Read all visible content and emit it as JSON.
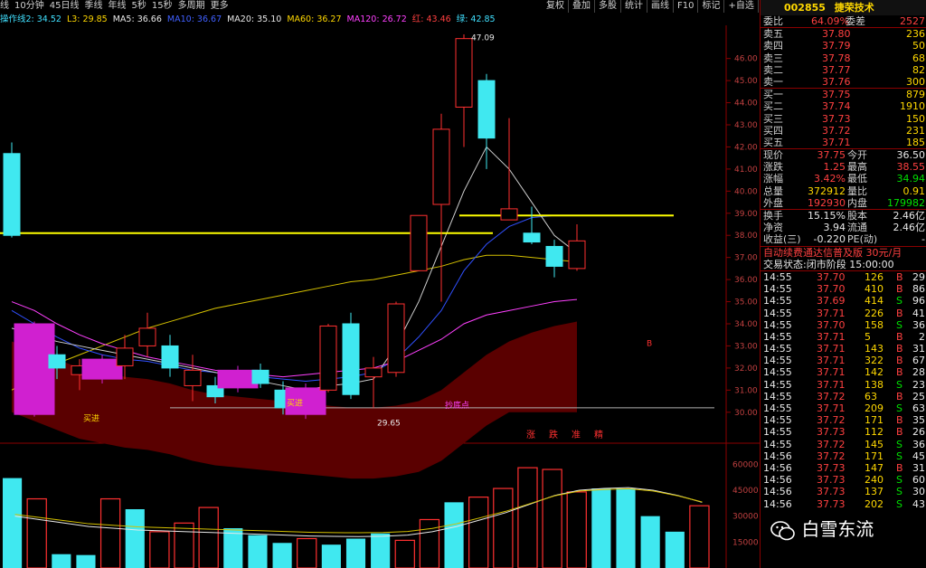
{
  "toolbar": {
    "items": [
      "线",
      "10分钟",
      "45日线",
      "季线",
      "年线",
      "5秒",
      "15秒",
      "多周期",
      "更多"
    ],
    "right_items": [
      "复权",
      "叠加",
      "多股",
      "统计",
      "画线",
      "F10",
      "标记",
      "+自选",
      "返回"
    ]
  },
  "indicators": [
    {
      "text": "操作线2: 34.52",
      "color": "#40e0ff"
    },
    {
      "text": "L3: 29.85",
      "color": "#ffd800"
    },
    {
      "text": "MA5: 36.66",
      "color": "#e8e8e8"
    },
    {
      "text": "MA10: 36.67",
      "color": "#4060ff"
    },
    {
      "text": "MA20: 35.10",
      "color": "#e8e8e8"
    },
    {
      "text": "MA60: 36.27",
      "color": "#ffd800"
    },
    {
      "text": "MA120: 26.72",
      "color": "#ff40ff"
    },
    {
      "text": "红: 43.46",
      "color": "#ff4040"
    },
    {
      "text": "绿: 42.85",
      "color": "#40e0ff"
    }
  ],
  "chart_data": {
    "type": "candlestick",
    "price_axis_ticks": [
      "46.00",
      "45.00",
      "44.00",
      "43.00",
      "42.00",
      "41.00",
      "40.00",
      "39.00",
      "38.00",
      "37.00",
      "36.00",
      "35.00",
      "34.00",
      "33.00",
      "32.00",
      "31.00",
      "30.00"
    ],
    "volume_axis_ticks": [
      "60000",
      "45000",
      "30000",
      "15000"
    ],
    "price_range": [
      29.5,
      47.5
    ],
    "annotations": {
      "high_label": "47.09",
      "low_label": "29.65",
      "buy1": "买进",
      "buy2": "买进",
      "buy3": "抄底点",
      "b_marker": "B",
      "bottom_tags": [
        "涨",
        "跌",
        "准",
        "精"
      ]
    },
    "candles": [
      {
        "o": 38.0,
        "c": 41.7,
        "h": 42.2,
        "l": 37.9,
        "color": "cyan"
      },
      {
        "o": 34.0,
        "c": 29.9,
        "h": 34.1,
        "l": 29.8,
        "color": "mag"
      },
      {
        "o": 32.0,
        "c": 32.6,
        "h": 33.0,
        "l": 31.5,
        "color": "cyan"
      },
      {
        "o": 31.7,
        "c": 32.1,
        "h": 32.4,
        "l": 31.0,
        "color": "red"
      },
      {
        "o": 31.5,
        "c": 32.4,
        "h": 32.6,
        "l": 31.3,
        "color": "mag"
      },
      {
        "o": 32.1,
        "c": 32.9,
        "h": 33.5,
        "l": 31.5,
        "color": "red"
      },
      {
        "o": 33.0,
        "c": 33.8,
        "h": 34.5,
        "l": 32.5,
        "color": "red"
      },
      {
        "o": 33.0,
        "c": 32.0,
        "h": 33.5,
        "l": 31.6,
        "color": "cyan"
      },
      {
        "o": 31.2,
        "c": 31.9,
        "h": 32.6,
        "l": 30.5,
        "color": "red"
      },
      {
        "o": 31.2,
        "c": 30.7,
        "h": 31.6,
        "l": 30.4,
        "color": "cyan"
      },
      {
        "o": 31.1,
        "c": 31.9,
        "h": 32.1,
        "l": 30.9,
        "color": "mag"
      },
      {
        "o": 31.9,
        "c": 31.3,
        "h": 32.2,
        "l": 31.1,
        "color": "cyan"
      },
      {
        "o": 31.0,
        "c": 30.2,
        "h": 31.4,
        "l": 29.9,
        "color": "cyan"
      },
      {
        "o": 29.9,
        "c": 31.1,
        "h": 31.3,
        "l": 29.7,
        "color": "mag"
      },
      {
        "o": 31.0,
        "c": 33.9,
        "h": 34.0,
        "l": 30.9,
        "color": "red"
      },
      {
        "o": 34.0,
        "c": 30.8,
        "h": 34.5,
        "l": 30.6,
        "color": "cyan"
      },
      {
        "o": 31.6,
        "c": 32.0,
        "h": 32.5,
        "l": 30.2,
        "color": "red"
      },
      {
        "o": 31.8,
        "c": 34.9,
        "h": 35.0,
        "l": 31.6,
        "color": "red"
      },
      {
        "o": 36.4,
        "c": 38.9,
        "h": 38.9,
        "l": 36.4,
        "color": "red"
      },
      {
        "o": 39.4,
        "c": 42.8,
        "h": 43.5,
        "l": 35.0,
        "color": "red"
      },
      {
        "o": 43.8,
        "c": 46.9,
        "h": 47.09,
        "l": 42.0,
        "color": "red"
      },
      {
        "o": 45.0,
        "c": 42.4,
        "h": 45.3,
        "l": 41.0,
        "color": "cyan"
      },
      {
        "o": 38.7,
        "c": 39.2,
        "h": 43.3,
        "l": 38.7,
        "color": "red"
      },
      {
        "o": 38.1,
        "c": 37.7,
        "h": 39.3,
        "l": 37.6,
        "color": "cyan"
      },
      {
        "o": 37.5,
        "c": 36.6,
        "h": 37.8,
        "l": 36.1,
        "color": "cyan"
      },
      {
        "o": 36.5,
        "c": 37.75,
        "h": 38.5,
        "l": 36.4,
        "color": "red"
      }
    ],
    "volumes": [
      {
        "v": 52000,
        "color": "cyan"
      },
      {
        "v": 40000,
        "color": "red"
      },
      {
        "v": 8000,
        "color": "cyan"
      },
      {
        "v": 7500,
        "color": "cyan"
      },
      {
        "v": 40000,
        "color": "red"
      },
      {
        "v": 34000,
        "color": "cyan"
      },
      {
        "v": 21000,
        "color": "red"
      },
      {
        "v": 26000,
        "color": "red"
      },
      {
        "v": 35000,
        "color": "red"
      },
      {
        "v": 23000,
        "color": "cyan"
      },
      {
        "v": 19000,
        "color": "cyan"
      },
      {
        "v": 14500,
        "color": "cyan"
      },
      {
        "v": 17000,
        "color": "red"
      },
      {
        "v": 13500,
        "color": "cyan"
      },
      {
        "v": 17000,
        "color": "cyan"
      },
      {
        "v": 20000,
        "color": "cyan"
      },
      {
        "v": 16000,
        "color": "red"
      },
      {
        "v": 28000,
        "color": "red"
      },
      {
        "v": 38000,
        "color": "cyan"
      },
      {
        "v": 41000,
        "color": "red"
      },
      {
        "v": 46000,
        "color": "red"
      },
      {
        "v": 58000,
        "color": "red"
      },
      {
        "v": 57000,
        "color": "red"
      },
      {
        "v": 44000,
        "color": "red"
      },
      {
        "v": 46000,
        "color": "cyan"
      },
      {
        "v": 46000,
        "color": "cyan"
      },
      {
        "v": 30000,
        "color": "cyan"
      },
      {
        "v": 21000,
        "color": "cyan"
      },
      {
        "v": 36000,
        "color": "red"
      }
    ]
  },
  "panel": {
    "code": "002855",
    "name": "捷荣技术",
    "weibi": {
      "label": "委比",
      "value": "64.09%",
      "label2": "委差",
      "value2": "2527"
    },
    "asks": [
      {
        "label": "卖五",
        "price": "37.80",
        "vol": "236"
      },
      {
        "label": "卖四",
        "price": "37.79",
        "vol": "50"
      },
      {
        "label": "卖三",
        "price": "37.78",
        "vol": "68"
      },
      {
        "label": "卖二",
        "price": "37.77",
        "vol": "82"
      },
      {
        "label": "卖一",
        "price": "37.76",
        "vol": "300"
      }
    ],
    "bids": [
      {
        "label": "买一",
        "price": "37.75",
        "vol": "879"
      },
      {
        "label": "买二",
        "price": "37.74",
        "vol": "1910"
      },
      {
        "label": "买三",
        "price": "37.73",
        "vol": "150"
      },
      {
        "label": "买四",
        "price": "37.72",
        "vol": "231"
      },
      {
        "label": "买五",
        "price": "37.71",
        "vol": "185"
      }
    ],
    "quote": [
      {
        "l1": "现价",
        "v1": "37.75",
        "c1": "red",
        "l2": "今开",
        "v2": "36.50",
        "c2": "white"
      },
      {
        "l1": "涨跌",
        "v1": "1.25",
        "c1": "red",
        "l2": "最高",
        "v2": "38.55",
        "c2": "red"
      },
      {
        "l1": "涨幅",
        "v1": "3.42%",
        "c1": "red",
        "l2": "最低",
        "v2": "34.94",
        "c2": "green"
      },
      {
        "l1": "总量",
        "v1": "372912",
        "c1": "yellow",
        "l2": "量比",
        "v2": "0.91",
        "c2": "yellow"
      },
      {
        "l1": "外盘",
        "v1": "192930",
        "c1": "red",
        "l2": "内盘",
        "v2": "179982",
        "c2": "green"
      }
    ],
    "quote2": [
      {
        "l1": "换手",
        "v1": "15.15%",
        "c1": "white",
        "l2": "股本",
        "v2": "2.46亿",
        "c2": "white"
      },
      {
        "l1": "净资",
        "v1": "3.94",
        "c1": "white",
        "l2": "流通",
        "v2": "2.46亿",
        "c2": "white"
      },
      {
        "l1": "收益(三)",
        "v1": "-0.220",
        "c1": "white",
        "l2": "PE(动)",
        "v2": "-",
        "c2": "white"
      }
    ],
    "ad": "自动续费通达信普及版 30元/月",
    "status": "交易状态:闭市阶段 15:00:00",
    "ticks": [
      {
        "t": "14:55",
        "p": "37.70",
        "v": "126",
        "s": "B",
        "n": "29"
      },
      {
        "t": "14:55",
        "p": "37.70",
        "v": "410",
        "s": "B",
        "n": "86"
      },
      {
        "t": "14:55",
        "p": "37.69",
        "v": "414",
        "s": "S",
        "n": "96"
      },
      {
        "t": "14:55",
        "p": "37.71",
        "v": "226",
        "s": "B",
        "n": "41"
      },
      {
        "t": "14:55",
        "p": "37.70",
        "v": "158",
        "s": "S",
        "n": "36"
      },
      {
        "t": "14:55",
        "p": "37.71",
        "v": "5",
        "s": "B",
        "n": "2"
      },
      {
        "t": "14:55",
        "p": "37.71",
        "v": "143",
        "s": "B",
        "n": "31"
      },
      {
        "t": "14:55",
        "p": "37.71",
        "v": "322",
        "s": "B",
        "n": "67"
      },
      {
        "t": "14:55",
        "p": "37.71",
        "v": "142",
        "s": "B",
        "n": "28"
      },
      {
        "t": "14:55",
        "p": "37.71",
        "v": "138",
        "s": "S",
        "n": "23"
      },
      {
        "t": "14:55",
        "p": "37.72",
        "v": "63",
        "s": "B",
        "n": "25"
      },
      {
        "t": "14:55",
        "p": "37.71",
        "v": "209",
        "s": "S",
        "n": "63"
      },
      {
        "t": "14:55",
        "p": "37.72",
        "v": "171",
        "s": "B",
        "n": "35"
      },
      {
        "t": "14:55",
        "p": "37.73",
        "v": "112",
        "s": "B",
        "n": "26"
      },
      {
        "t": "14:55",
        "p": "37.72",
        "v": "145",
        "s": "S",
        "n": "36"
      },
      {
        "t": "14:56",
        "p": "37.72",
        "v": "171",
        "s": "S",
        "n": "45"
      },
      {
        "t": "14:56",
        "p": "37.73",
        "v": "147",
        "s": "B",
        "n": "31"
      },
      {
        "t": "14:56",
        "p": "37.73",
        "v": "240",
        "s": "S",
        "n": "60"
      },
      {
        "t": "14:56",
        "p": "37.73",
        "v": "137",
        "s": "S",
        "n": "30"
      },
      {
        "t": "14:56",
        "p": "37.73",
        "v": "202",
        "s": "S",
        "n": "43"
      }
    ],
    "watermark": "白雪东流"
  }
}
